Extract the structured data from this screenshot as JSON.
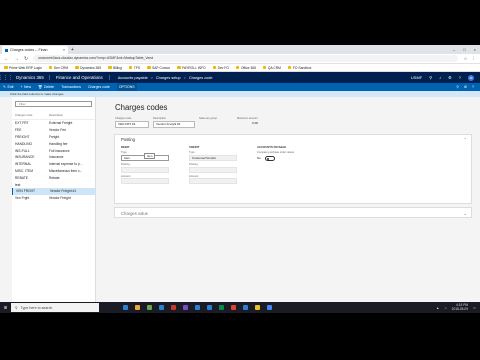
{
  "browser": {
    "tab_title": "Charges codes -- Finan",
    "new_tab_symbol": "+",
    "close_symbol": "×",
    "window_controls": [
      "–",
      "□",
      "×"
    ],
    "url": "usnconeb3aos.cloudax.dynamics.com/?cmp=USMF&mi=MarkupTable_Vend",
    "bookmarks": [
      "Prime Web ERP Login",
      "Dev CRM",
      "Dynamics 365",
      "Billing",
      "TFS",
      "SAP Concur",
      "PAYROLL INFO",
      "Dev FO",
      "Office 365",
      "QA CRM",
      "FO Sandbox"
    ]
  },
  "d365": {
    "waffle_symbol": "⋮⋮⋮",
    "product": "Dynamics 365",
    "module": "Finance and Operations",
    "breadcrumbs": [
      "Accounts payable",
      "Charges setup",
      "Charges code"
    ],
    "breadcrumb_sep": ">",
    "company": "USMF",
    "avatar": "JK"
  },
  "actions": {
    "items": [
      "Edit",
      "New",
      "Delete",
      "Transactions",
      "Charges code",
      "OPTIONS"
    ],
    "right_icons": [
      "⚲",
      "⚙",
      "?"
    ]
  },
  "message": "Click the field columns to make changes",
  "list": {
    "filter_placeholder": "Filter",
    "headers": [
      "Charges code",
      "Description"
    ],
    "rows": [
      {
        "code": "EXT FRT",
        "desc": "External Freight"
      },
      {
        "code": "FEE",
        "desc": "Vendor Fee"
      },
      {
        "code": "FREIGHT",
        "desc": "Freight"
      },
      {
        "code": "HANDLING",
        "desc": "Handling fee"
      },
      {
        "code": "INS-FULL",
        "desc": "Full insurance"
      },
      {
        "code": "INSURANCE",
        "desc": "Insurance"
      },
      {
        "code": "INTERNAL",
        "desc": "Internal expense to p..."
      },
      {
        "code": "MISC. ITEM",
        "desc": "Miscellaneous item c..."
      },
      {
        "code": "REBATE",
        "desc": "Rebate"
      },
      {
        "code": "test",
        "desc": ""
      },
      {
        "code": "VEN FRGHT",
        "desc": "Vendor Freight #1",
        "selected": true
      },
      {
        "code": "Ven Frght",
        "desc": "Vendor Freight"
      }
    ]
  },
  "detail": {
    "title": "Charges codes",
    "header_fields": [
      {
        "label": "Charges code",
        "value": "VEN FRT #1"
      },
      {
        "label": "Description",
        "value": "Vendor Freight #1"
      },
      {
        "label": "Sales tax group",
        "value": ""
      },
      {
        "label": "Maximum amount",
        "value": "0.00"
      }
    ],
    "posting": {
      "title": "Posting",
      "chevron": "⌃",
      "debit_group": "DEBIT",
      "credit_group": "CREDIT",
      "type_label": "Type",
      "debit_type": "Item",
      "tooltip": "Item",
      "credit_type": "Customer/Vendor",
      "posting_label": "Posting",
      "account_label": "Account",
      "account_value": "",
      "posting_value": "",
      "accounts_group": "ACCOUNTS PAYABLE",
      "accounts_note": "Compare purchase order values",
      "toggle_label": "No"
    },
    "charges_value": {
      "title": "Charges value",
      "chevron": "⌄"
    }
  },
  "taskbar": {
    "start_symbol": "⊞",
    "search_placeholder": "Type here to search",
    "time": "4:15 PM",
    "date": "2018-05-09",
    "icon_colors": [
      "#2d7fd1",
      "#e9a93a",
      "#6aa84f",
      "#2d7fd1",
      "#c53a2c",
      "#7a4bc7",
      "#2d7fd1",
      "#2d7fd1",
      "#0d8a4a",
      "#d9472b",
      "#2d7fd1",
      "#e6c229",
      "#4285f4"
    ]
  }
}
